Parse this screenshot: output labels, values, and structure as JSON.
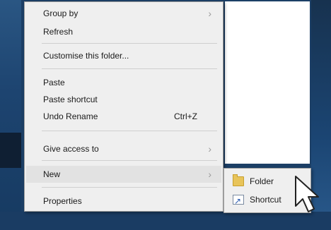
{
  "context_menu": {
    "items": [
      {
        "label": "Group by",
        "has_submenu": true
      },
      {
        "label": "Refresh"
      },
      {
        "label": "Customise this folder..."
      },
      {
        "label": "Paste"
      },
      {
        "label": "Paste shortcut"
      },
      {
        "label": "Undo Rename",
        "shortcut": "Ctrl+Z"
      },
      {
        "label": "Give access to",
        "has_submenu": true
      },
      {
        "label": "New",
        "has_submenu": true,
        "highlighted": true
      },
      {
        "label": "Properties"
      }
    ],
    "chevron": "›"
  },
  "new_submenu": {
    "items": [
      {
        "label": "Folder",
        "icon": "folder-icon"
      },
      {
        "label": "Shortcut",
        "icon": "shortcut-icon"
      }
    ]
  },
  "colors": {
    "menu_bg": "#efefef",
    "hover_bg": "#e2e2e2",
    "desktop": "#1c3f66",
    "folder": "#e8c45a"
  }
}
